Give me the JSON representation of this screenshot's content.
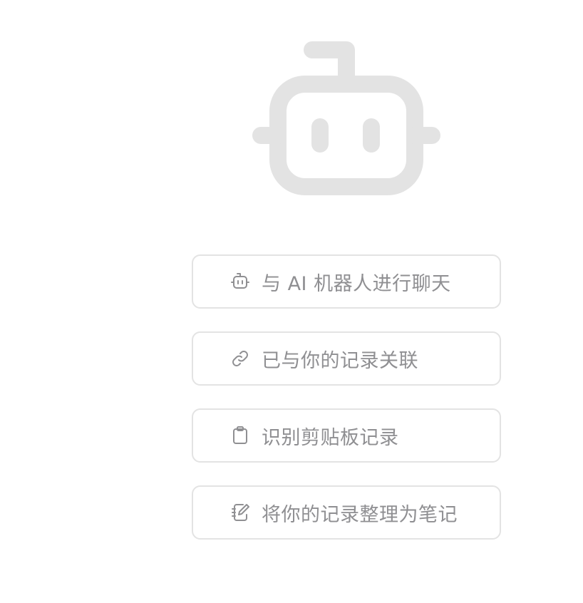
{
  "hero": {
    "icon": "robot-icon",
    "color": "#e3e3e3"
  },
  "actions": [
    {
      "icon": "robot-icon",
      "label": "与 AI 机器人进行聊天"
    },
    {
      "icon": "link-icon",
      "label": "已与你的记录关联"
    },
    {
      "icon": "clipboard-icon",
      "label": "识别剪贴板记录"
    },
    {
      "icon": "notebook-edit-icon",
      "label": "将你的记录整理为笔记"
    }
  ],
  "colors": {
    "border": "#e3e3e3",
    "text": "#8f8f92",
    "icon": "#8f8f92",
    "background": "#ffffff"
  }
}
